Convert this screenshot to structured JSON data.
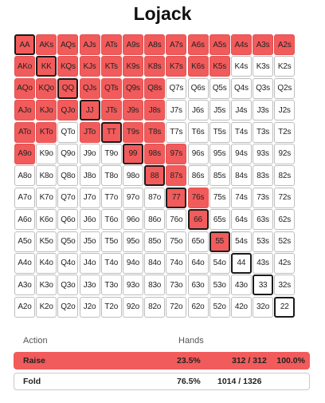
{
  "title": "Lojack",
  "grid": {
    "rows": [
      [
        "AA",
        "AKs",
        "AQs",
        "AJs",
        "ATs",
        "A9s",
        "A8s",
        "A7s",
        "A6s",
        "A5s",
        "A4s",
        "A3s",
        "A2s"
      ],
      [
        "AKo",
        "KK",
        "KQs",
        "KJs",
        "KTs",
        "K9s",
        "K8s",
        "K7s",
        "K6s",
        "K5s",
        "K4s",
        "K3s",
        "K2s"
      ],
      [
        "AQo",
        "KQo",
        "QQ",
        "QJs",
        "QTs",
        "Q9s",
        "Q8s",
        "Q7s",
        "Q6s",
        "Q5s",
        "Q4s",
        "Q3s",
        "Q2s"
      ],
      [
        "AJo",
        "KJo",
        "QJo",
        "JJ",
        "JTs",
        "J9s",
        "J8s",
        "J7s",
        "J6s",
        "J5s",
        "J4s",
        "J3s",
        "J2s"
      ],
      [
        "ATo",
        "KTo",
        "QTo",
        "JTo",
        "TT",
        "T9s",
        "T8s",
        "T7s",
        "T6s",
        "T5s",
        "T4s",
        "T3s",
        "T2s"
      ],
      [
        "A9o",
        "K9o",
        "Q9o",
        "J9o",
        "T9o",
        "99",
        "98s",
        "97s",
        "96s",
        "95s",
        "94s",
        "93s",
        "92s"
      ],
      [
        "A8o",
        "K8o",
        "Q8o",
        "J8o",
        "T8o",
        "98o",
        "88",
        "87s",
        "86s",
        "85s",
        "84s",
        "83s",
        "82s"
      ],
      [
        "A7o",
        "K7o",
        "Q7o",
        "J7o",
        "T7o",
        "97o",
        "87o",
        "77",
        "76s",
        "75s",
        "74s",
        "73s",
        "72s"
      ],
      [
        "A6o",
        "K6o",
        "Q6o",
        "J6o",
        "T6o",
        "96o",
        "86o",
        "76o",
        "66",
        "65s",
        "64s",
        "63s",
        "62s"
      ],
      [
        "A5o",
        "K5o",
        "Q5o",
        "J5o",
        "T5o",
        "95o",
        "85o",
        "75o",
        "65o",
        "55",
        "54s",
        "53s",
        "52s"
      ],
      [
        "A4o",
        "K4o",
        "Q4o",
        "J4o",
        "T4o",
        "94o",
        "84o",
        "74o",
        "64o",
        "54o",
        "44",
        "43s",
        "42s"
      ],
      [
        "A3o",
        "K3o",
        "Q3o",
        "J3o",
        "T3o",
        "93o",
        "83o",
        "73o",
        "63o",
        "53o",
        "43o",
        "33",
        "32s"
      ],
      [
        "A2o",
        "K2o",
        "Q2o",
        "J2o",
        "T2o",
        "92o",
        "82o",
        "72o",
        "62o",
        "52o",
        "42o",
        "32o",
        "22"
      ]
    ],
    "raise_hands": [
      "AA",
      "AKs",
      "AQs",
      "AJs",
      "ATs",
      "A9s",
      "A8s",
      "A7s",
      "A6s",
      "A5s",
      "A4s",
      "A3s",
      "A2s",
      "AKo",
      "KK",
      "KQs",
      "KJs",
      "KTs",
      "K9s",
      "K8s",
      "K7s",
      "K6s",
      "K5s",
      "AQo",
      "KQo",
      "QQ",
      "QJs",
      "QTs",
      "Q9s",
      "Q8s",
      "AJo",
      "KJo",
      "QJo",
      "JJ",
      "JTs",
      "J9s",
      "J8s",
      "ATo",
      "KTo",
      "JTo",
      "TT",
      "T9s",
      "T8s",
      "A9o",
      "99",
      "98s",
      "97s",
      "88",
      "87s",
      "77",
      "76s",
      "66",
      "55"
    ]
  },
  "table": {
    "action_header": "Action",
    "hands_header": "Hands",
    "rows": [
      {
        "action": "Raise",
        "percent": "23.5%",
        "combos": "312 / 312",
        "frequency": "100.0%"
      },
      {
        "action": "Fold",
        "percent": "76.5%",
        "combos": "1014 / 1326",
        "frequency": ""
      }
    ]
  },
  "colors": {
    "raise": "#f25b5b",
    "fold": "#ffffff",
    "pair_border": "#1a1a1a"
  }
}
